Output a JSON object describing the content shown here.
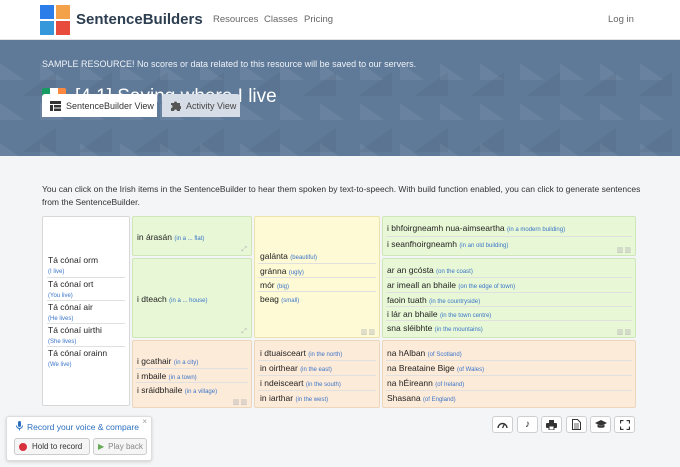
{
  "nav": {
    "brand": "SentenceBuilders",
    "links": [
      "Resources",
      "Classes",
      "Pricing"
    ],
    "login": "Log in"
  },
  "colors": {
    "logo": [
      "#2b7de9",
      "#f4a24a",
      "#e74c3c",
      "#3498db"
    ],
    "flag": [
      "#169b62",
      "#ffffff",
      "#ff883e"
    ]
  },
  "banner": {
    "notice": "SAMPLE RESOURCE! No scores or data related to this resource will be saved to our servers.",
    "title": "[4.1] Saying where I live"
  },
  "tabs": [
    {
      "label": "SentenceBuilder View",
      "icon": "grid-icon"
    },
    {
      "label": "Activity View",
      "icon": "puzzle-icon"
    }
  ],
  "intro": "You can click on the Irish items in the SentenceBuilder to hear them spoken by text-to-speech. With build function enabled, you can click to generate sentences from the SentenceBuilder.",
  "column1": [
    {
      "text": "Tá cónaí orm",
      "trans": "(I live)"
    },
    {
      "text": "Tá cónaí ort",
      "trans": "(You live)"
    },
    {
      "text": "Tá cónaí air",
      "trans": "(He lives)"
    },
    {
      "text": "Tá cónaí uirthi",
      "trans": "(She lives)"
    },
    {
      "text": "Tá cónaí orainn",
      "trans": "(We live)"
    }
  ],
  "column2": {
    "flat": [
      {
        "text": "in árasán",
        "trans": "(in a ... flat)"
      }
    ],
    "house": [
      {
        "text": "i dteach",
        "trans": "(in a ... house)"
      }
    ],
    "places": [
      {
        "text": "i gcathair",
        "trans": "(in a city)"
      },
      {
        "text": "i mbaile",
        "trans": "(in a town)"
      },
      {
        "text": "i sráidbhaile",
        "trans": "(in a village)"
      }
    ]
  },
  "column3": {
    "adjectives": [
      {
        "text": "galánta",
        "trans": "(beautiful)"
      },
      {
        "text": "gránna",
        "trans": "(ugly)"
      },
      {
        "text": "mór",
        "trans": "(big)"
      },
      {
        "text": "beag",
        "trans": "(small)"
      }
    ],
    "directions": [
      {
        "text": "i dtuaisceart",
        "trans": "(in the north)"
      },
      {
        "text": "in oirthear",
        "trans": "(in the east)"
      },
      {
        "text": "i ndeisceart",
        "trans": "(in the south)"
      },
      {
        "text": "in iarthar",
        "trans": "(in the west)"
      }
    ]
  },
  "column4": {
    "buildings": [
      {
        "text": "i bhfoirgneamh nua-aimseartha",
        "trans": "(in a modern building)"
      },
      {
        "text": "i seanfhoirgneamh",
        "trans": "(in an old building)"
      }
    ],
    "locations": [
      {
        "text": "ar an gcósta",
        "trans": "(on the coast)"
      },
      {
        "text": "ar imeall an bhaile",
        "trans": "(on the edge of town)"
      },
      {
        "text": "faoin tuath",
        "trans": "(in the countryside)"
      },
      {
        "text": "i lár an bhaile",
        "trans": "(in the town centre)"
      },
      {
        "text": "sna sléibhte",
        "trans": "(in the mountains)"
      }
    ],
    "countries": [
      {
        "text": "na hAlban",
        "trans": "(of Scotland)"
      },
      {
        "text": "na Breataine Bige",
        "trans": "(of Wales)"
      },
      {
        "text": "na hÉireann",
        "trans": "(of Ireland)"
      },
      {
        "text": "Shasana",
        "trans": "(of England)"
      }
    ]
  },
  "recorder": {
    "title": "Record your voice & compare",
    "close": "×",
    "hold": "Hold to record",
    "play": "Play back"
  }
}
